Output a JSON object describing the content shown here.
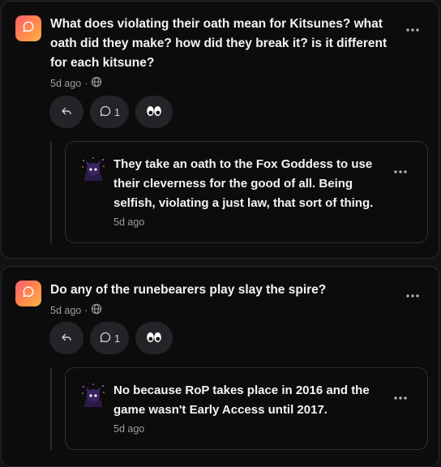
{
  "posts": [
    {
      "question": "What does violating their oath mean for Kitsunes? what oath did they make? how did they break it? is it different for each kitsune?",
      "time": "5d ago",
      "visibility_icon": "globe-icon",
      "comment_count": "1",
      "reply": {
        "text": "They take an oath to the Fox Goddess to use their cleverness for the good of all. Being selfish, violating a just law, that sort of thing.",
        "time": "5d ago"
      }
    },
    {
      "question": "Do any of the runebearers play slay the spire?",
      "time": "5d ago",
      "visibility_icon": "globe-icon",
      "comment_count": "1",
      "reply": {
        "text": "No because RoP takes place in 2016 and the game wasn't Early Access until 2017.",
        "time": "5d ago"
      }
    }
  ],
  "colors": {
    "card_bg": "#0c0c0d",
    "page_bg": "#131315",
    "button_bg": "#242428",
    "muted_text": "#9c9ca3",
    "avatar_gradient_start": "#ff5f6d",
    "avatar_gradient_end": "#ffb347"
  }
}
